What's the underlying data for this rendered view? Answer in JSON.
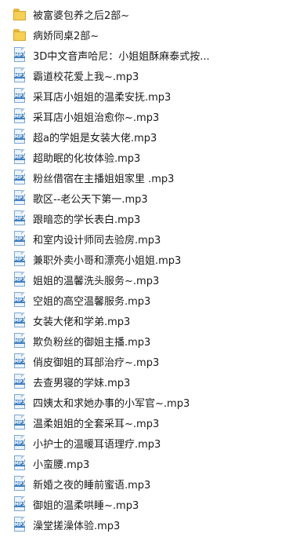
{
  "items": [
    {
      "type": "folder",
      "name": "被富婆包养之后2部~"
    },
    {
      "type": "folder",
      "name": "病娇同桌2部~"
    },
    {
      "type": "mp3",
      "name": "3D中文音声哈尼：小姐姐酥麻泰式按..."
    },
    {
      "type": "mp3",
      "name": "霸道校花爱上我~.mp3"
    },
    {
      "type": "mp3",
      "name": "采耳店小姐姐的温柔安抚.mp3"
    },
    {
      "type": "mp3",
      "name": "采耳店小姐姐治愈你~.mp3"
    },
    {
      "type": "mp3",
      "name": "超a的学姐是女装大佬.mp3"
    },
    {
      "type": "mp3",
      "name": "超助眠的化妆体验.mp3"
    },
    {
      "type": "mp3",
      "name": "粉丝借宿在主播姐姐家里 .mp3"
    },
    {
      "type": "mp3",
      "name": "歌区--老公天下第一.mp3"
    },
    {
      "type": "mp3",
      "name": "跟暗恋的学长表白.mp3"
    },
    {
      "type": "mp3",
      "name": "和室内设计师同去验房.mp3"
    },
    {
      "type": "mp3",
      "name": "兼职外卖小哥和漂亮小姐姐.mp3"
    },
    {
      "type": "mp3",
      "name": "姐姐的温馨洗头服务~.mp3"
    },
    {
      "type": "mp3",
      "name": "空姐的高空温馨服务.mp3"
    },
    {
      "type": "mp3",
      "name": "女装大佬和学弟.mp3"
    },
    {
      "type": "mp3",
      "name": "欺负粉丝的御姐主播.mp3"
    },
    {
      "type": "mp3",
      "name": "俏皮御姐的耳部治疗~.mp3"
    },
    {
      "type": "mp3",
      "name": "去查男寝的学妹.mp3"
    },
    {
      "type": "mp3",
      "name": "四姨太和求她办事的小军官~.mp3"
    },
    {
      "type": "mp3",
      "name": "温柔姐姐的全套采耳~.mp3"
    },
    {
      "type": "mp3",
      "name": "小护士的温暖耳语理疗.mp3"
    },
    {
      "type": "mp3",
      "name": "小蛮腰.mp3"
    },
    {
      "type": "mp3",
      "name": "新婚之夜的睡前蜜语.mp3"
    },
    {
      "type": "mp3",
      "name": "御姐的温柔哄睡~.mp3"
    },
    {
      "type": "mp3",
      "name": "澡堂搓澡体验.mp3"
    }
  ],
  "icons": {
    "folder": "folder-icon",
    "mp3": "mp3-file-icon",
    "mp3_badge": "MP3"
  }
}
